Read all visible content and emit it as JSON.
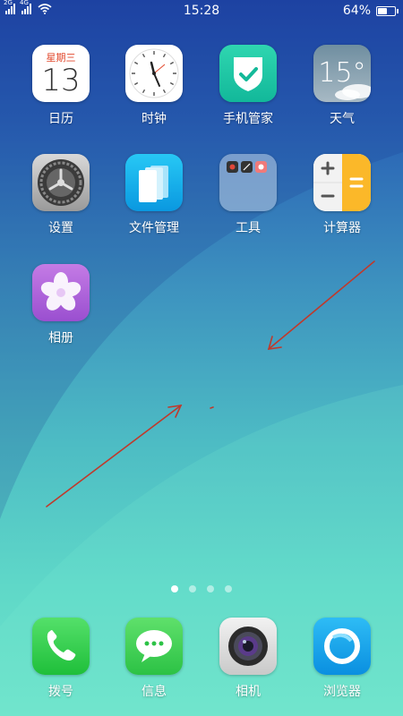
{
  "status_bar": {
    "sim1_tag": "2G",
    "sim2_tag": "4G",
    "time": "15:28",
    "battery_text": "64%",
    "battery_level": 0.64
  },
  "apps": [
    {
      "label": "日历",
      "icon": "calendar-icon",
      "weekday": "星期三",
      "day": "13"
    },
    {
      "label": "时钟",
      "icon": "clock-icon"
    },
    {
      "label": "手机管家",
      "icon": "shield-check-icon"
    },
    {
      "label": "天气",
      "icon": "weather-icon",
      "temp": "15°"
    },
    {
      "label": "设置",
      "icon": "gear-icon"
    },
    {
      "label": "文件管理",
      "icon": "files-icon"
    },
    {
      "label": "工具",
      "icon": "tools-folder-icon"
    },
    {
      "label": "计算器",
      "icon": "calculator-icon"
    },
    {
      "label": "相册",
      "icon": "flower-gallery-icon"
    }
  ],
  "page_indicator": {
    "count": 4,
    "active": 0
  },
  "dock": [
    {
      "label": "拨号",
      "icon": "phone-icon"
    },
    {
      "label": "信息",
      "icon": "message-icon"
    },
    {
      "label": "相机",
      "icon": "camera-icon"
    },
    {
      "label": "浏览器",
      "icon": "browser-icon"
    }
  ],
  "colors": {
    "arrow": "#c0392b",
    "calendar_weekday": "#e2482c",
    "phone_green": "#3ccf4e",
    "browser_blue": "#1aa3e8"
  }
}
